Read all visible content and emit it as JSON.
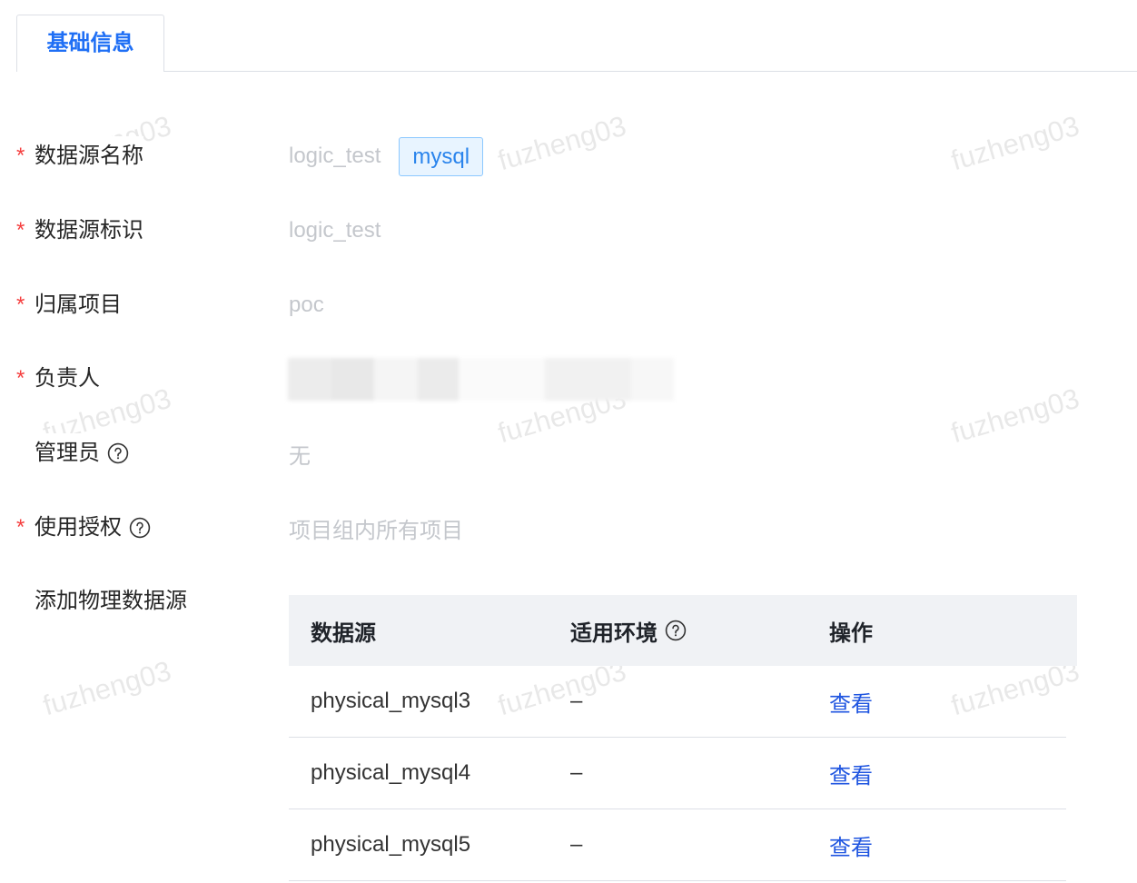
{
  "colors": {
    "accent": "#1f6ff5",
    "link": "#1f55e0",
    "required": "#f53f3f",
    "muted": "#c4c7cc",
    "tag_text": "#2a84ec",
    "tag_bg": "#e8f4ff",
    "tag_border": "#8cc8ff",
    "header_bg": "#f0f2f5"
  },
  "tabs": [
    {
      "label": "基础信息",
      "active": true
    }
  ],
  "form": {
    "required_mark": "*",
    "fields": {
      "name": {
        "label": "数据源名称",
        "required": true,
        "value": "logic_test",
        "tag": "mysql"
      },
      "identifier": {
        "label": "数据源标识",
        "required": true,
        "value": "logic_test"
      },
      "project": {
        "label": "归属项目",
        "required": true,
        "value": "poc"
      },
      "owner": {
        "label": "负责人",
        "required": true
      },
      "admin": {
        "label": "管理员",
        "required": false,
        "value": "无",
        "help_icon": "question-circle-icon"
      },
      "authorization": {
        "label": "使用授权",
        "required": true,
        "value": "项目组内所有项目",
        "help_icon": "question-circle-icon"
      },
      "physical_sources": {
        "label": "添加物理数据源",
        "required": false
      }
    }
  },
  "table": {
    "columns": [
      {
        "label": "数据源"
      },
      {
        "label": "适用环境",
        "help_icon": "question-circle-icon"
      },
      {
        "label": "操作"
      }
    ],
    "rows": [
      {
        "source": "physical_mysql3",
        "environment": "–",
        "action": "查看"
      },
      {
        "source": "physical_mysql4",
        "environment": "–",
        "action": "查看"
      },
      {
        "source": "physical_mysql5",
        "environment": "–",
        "action": "查看"
      }
    ]
  },
  "watermark": {
    "text": "fuzheng03"
  }
}
